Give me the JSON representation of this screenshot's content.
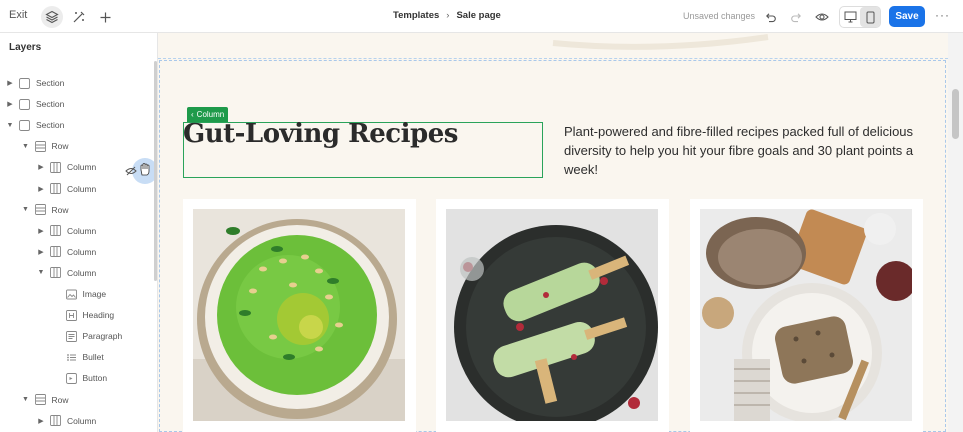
{
  "topbar": {
    "exit_label": "Exit",
    "breadcrumb": {
      "parent": "Templates",
      "current": "Sale page"
    },
    "status": "Unsaved changes",
    "save_label": "Save",
    "more_label": "···"
  },
  "sidebar": {
    "title": "Layers",
    "items": [
      {
        "label": "Section",
        "indent": 0,
        "caret": "right",
        "icon": "section-icon"
      },
      {
        "label": "Section",
        "indent": 0,
        "caret": "right",
        "icon": "section-icon"
      },
      {
        "label": "Section",
        "indent": 0,
        "caret": "down",
        "icon": "section-icon"
      },
      {
        "label": "Row",
        "indent": 1,
        "caret": "down",
        "icon": "row-icon"
      },
      {
        "label": "Column",
        "indent": 2,
        "caret": "right",
        "icon": "column-icon"
      },
      {
        "label": "Column",
        "indent": 2,
        "caret": "right",
        "icon": "column-icon"
      },
      {
        "label": "Row",
        "indent": 1,
        "caret": "down",
        "icon": "row-icon"
      },
      {
        "label": "Column",
        "indent": 2,
        "caret": "right",
        "icon": "column-icon"
      },
      {
        "label": "Column",
        "indent": 2,
        "caret": "right",
        "icon": "column-icon"
      },
      {
        "label": "Column",
        "indent": 2,
        "caret": "down",
        "icon": "column-icon"
      },
      {
        "label": "Image",
        "indent": 3,
        "caret": "none",
        "icon": "image-icon"
      },
      {
        "label": "Heading",
        "indent": 3,
        "caret": "none",
        "icon": "heading-icon"
      },
      {
        "label": "Paragraph",
        "indent": 3,
        "caret": "none",
        "icon": "paragraph-icon"
      },
      {
        "label": "Bullet",
        "indent": 3,
        "caret": "none",
        "icon": "bullet-icon"
      },
      {
        "label": "Button",
        "indent": 3,
        "caret": "none",
        "icon": "button-icon"
      },
      {
        "label": "Row",
        "indent": 1,
        "caret": "down",
        "icon": "row-icon"
      },
      {
        "label": "Column",
        "indent": 2,
        "caret": "right",
        "icon": "column-icon"
      }
    ]
  },
  "canvas": {
    "column_tag": "Column",
    "heading": "Gut-Loving Recipes",
    "intro_lines": [
      "Plant-powered and fibre-filled recipes packed full of delicious",
      "diversity to help you hit your fibre goals and 30 plant points a",
      "week!"
    ],
    "cards": [
      {
        "image": "green-hummus-bowl"
      },
      {
        "image": "green-ice-pops"
      },
      {
        "image": "seeded-bread-slices"
      }
    ]
  },
  "colors": {
    "accent": "#1a73e8",
    "selection": "#2aa35a",
    "canvas_bg": "#faf6ef"
  }
}
